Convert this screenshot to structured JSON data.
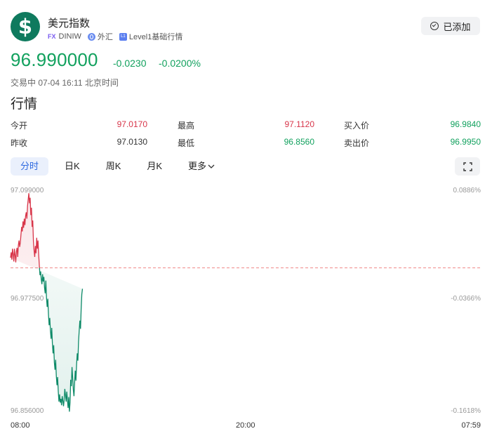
{
  "header": {
    "logo_symbol": "$",
    "title": "美元指数",
    "tag_fx": "FX",
    "code": "DINIW",
    "market": "外汇",
    "level_badge": "L1",
    "level": "Level1基础行情",
    "added_label": "已添加"
  },
  "quote": {
    "price": "96.990000",
    "change": "-0.0230",
    "change_pct": "-0.0200%",
    "status": "交易中 07-04 16:11 北京时间"
  },
  "section_title": "行情",
  "stats": [
    {
      "label": "今开",
      "value": "97.0170",
      "color": "red"
    },
    {
      "label": "最高",
      "value": "97.1120",
      "color": "red"
    },
    {
      "label": "买入价",
      "value": "96.9840",
      "color": "green"
    },
    {
      "label": "昨收",
      "value": "97.0130",
      "color": "dark"
    },
    {
      "label": "最低",
      "value": "96.8560",
      "color": "green"
    },
    {
      "label": "卖出价",
      "value": "96.9950",
      "color": "green"
    }
  ],
  "tabs": [
    {
      "label": "分时",
      "active": true
    },
    {
      "label": "日K",
      "active": false
    },
    {
      "label": "周K",
      "active": false
    },
    {
      "label": "月K",
      "active": false
    },
    {
      "label": "更多",
      "active": false
    }
  ],
  "chart_data": {
    "type": "line",
    "y_max_label": "97.099000",
    "y_mid_label": "96.977500",
    "y_min_label": "96.856000",
    "pct_max_label": "0.0886%",
    "pct_mid_label": "-0.0366%",
    "pct_min_label": "-0.1618%",
    "x_labels": [
      "08:00",
      "20:00",
      "07:59"
    ],
    "ylim": [
      96.856,
      97.099
    ],
    "prev_close": 97.013,
    "colors": {
      "up": "#d8364a",
      "down": "#0e8a68",
      "baseline": "#f08a8a"
    },
    "x": [
      0,
      2,
      4,
      6,
      8,
      10,
      12,
      14,
      16,
      18,
      20,
      22,
      24,
      26,
      28,
      30,
      32,
      34,
      36,
      38,
      40,
      42,
      44,
      46,
      48,
      50,
      52,
      54,
      56,
      58,
      60,
      62,
      64,
      66,
      68,
      70,
      72,
      74,
      76,
      78,
      80,
      82,
      84,
      86,
      88,
      90,
      92,
      94,
      96,
      98,
      100,
      102,
      104,
      106,
      108,
      110,
      112,
      114,
      116,
      118,
      120,
      122,
      124,
      126,
      128,
      130,
      132,
      134,
      136,
      138,
      140,
      142,
      144,
      146,
      148,
      150,
      152,
      154,
      156,
      158,
      160,
      162,
      164,
      166,
      168,
      170,
      172,
      174,
      176,
      178,
      180,
      182,
      184,
      186,
      188,
      190,
      192,
      194,
      196,
      198,
      200,
      202,
      204,
      206,
      208,
      210,
      212,
      214,
      216,
      218,
      220,
      222,
      224,
      226,
      228,
      230,
      232,
      234,
      236,
      238,
      240,
      242,
      244,
      246,
      248,
      250,
      252,
      254,
      256,
      258,
      260,
      262,
      264,
      266,
      268,
      270,
      272,
      274,
      276,
      278,
      280,
      282,
      284,
      286,
      288
    ],
    "values": [
      97.024,
      97.03,
      97.022,
      97.034,
      97.028,
      97.02,
      97.034,
      97.027,
      97.019,
      97.031,
      97.035,
      97.025,
      97.038,
      97.043,
      97.036,
      97.041,
      97.05,
      97.058,
      97.053,
      97.064,
      97.057,
      97.067,
      97.06,
      97.07,
      97.074,
      97.067,
      97.081,
      97.088,
      97.095,
      97.084,
      97.09,
      97.071,
      97.079,
      97.058,
      97.065,
      97.042,
      97.032,
      97.025,
      97.037,
      97.029,
      97.046,
      97.034,
      97.043,
      97.028,
      97.016,
      97.005,
      97.009,
      97.0,
      96.995,
      97.006,
      96.998,
      97.003,
      96.991,
      96.985,
      96.999,
      96.98,
      96.97,
      96.979,
      96.962,
      96.95,
      96.958,
      96.944,
      96.935,
      96.947,
      96.93,
      96.919,
      96.928,
      96.909,
      96.901,
      96.912,
      96.894,
      96.884,
      96.893,
      96.877,
      96.866,
      96.874,
      96.865,
      96.869,
      96.862,
      96.872,
      96.867,
      96.861,
      96.868,
      96.88,
      96.873,
      96.866,
      96.877,
      96.868,
      96.859,
      96.871,
      96.855,
      96.865,
      96.89,
      96.883,
      96.904,
      96.892,
      96.879,
      96.872,
      96.887,
      96.9,
      96.889,
      96.907,
      96.919,
      96.911,
      96.932,
      96.944,
      96.955,
      96.946,
      96.968,
      96.984,
      96.99
    ]
  }
}
